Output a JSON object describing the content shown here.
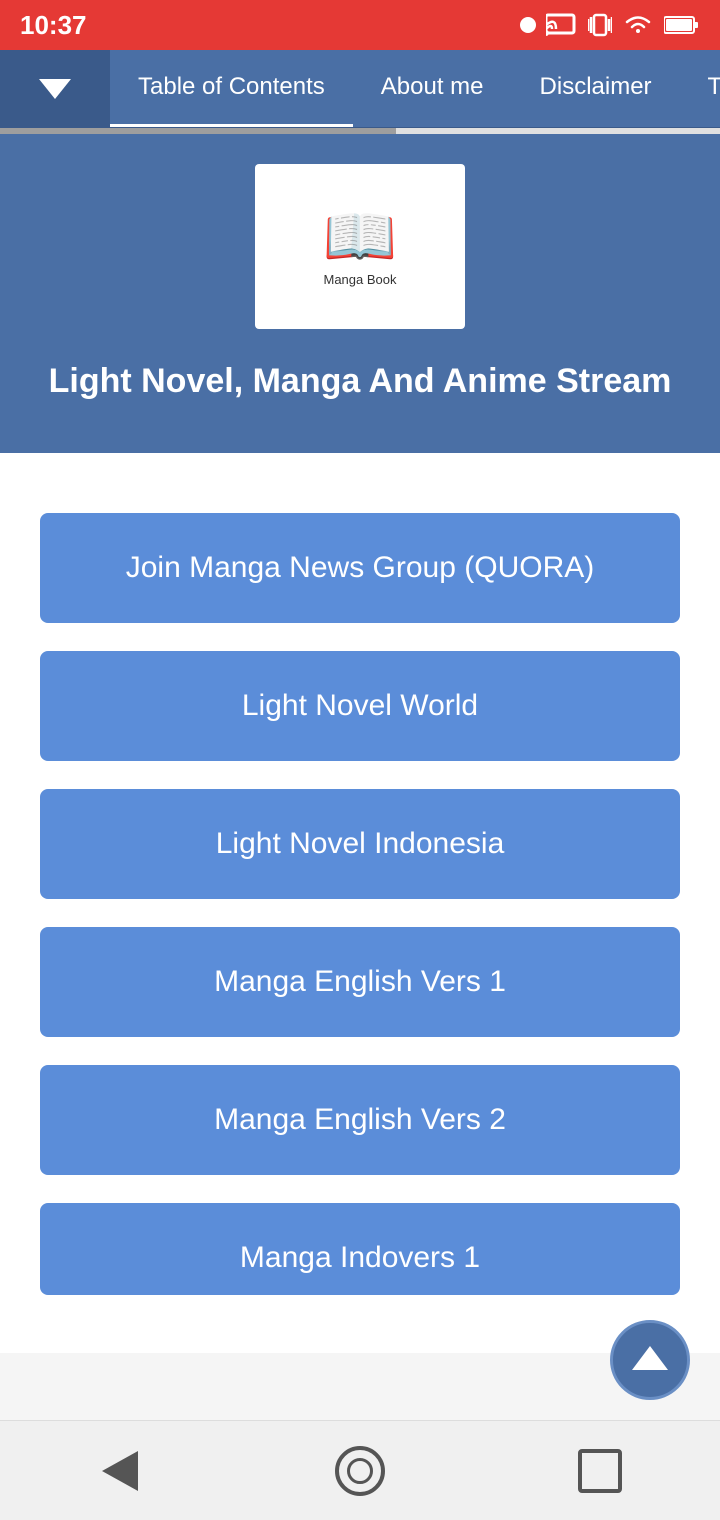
{
  "status_bar": {
    "time": "10:37",
    "dot_label": "status-dot"
  },
  "nav": {
    "dropdown_label": "chevron-down",
    "tabs": [
      {
        "id": "tab-toc",
        "label": "Table of Contents",
        "active": true
      },
      {
        "id": "tab-about",
        "label": "About me",
        "active": false
      },
      {
        "id": "tab-disclaimer",
        "label": "Disclaimer",
        "active": false
      },
      {
        "id": "tab-terms",
        "label": "Te...",
        "active": false
      }
    ]
  },
  "hero": {
    "logo_emoji": "📚",
    "logo_text": "Manga Book",
    "title": "Light Novel, Manga And Anime Stream"
  },
  "buttons": [
    {
      "id": "btn-quora",
      "label": "Join Manga News Group (QUORA)"
    },
    {
      "id": "btn-lnw",
      "label": "Light Novel World"
    },
    {
      "id": "btn-lni",
      "label": "Light Novel Indonesia"
    },
    {
      "id": "btn-me1",
      "label": "Manga English Vers 1"
    },
    {
      "id": "btn-me2",
      "label": "Manga English Vers 2"
    },
    {
      "id": "btn-mi1",
      "label": "Manga Indovers 1"
    }
  ],
  "scroll_top": {
    "label": "scroll-to-top"
  },
  "bottom_nav": {
    "back_label": "Back",
    "home_label": "Home",
    "recent_label": "Recent Apps"
  }
}
